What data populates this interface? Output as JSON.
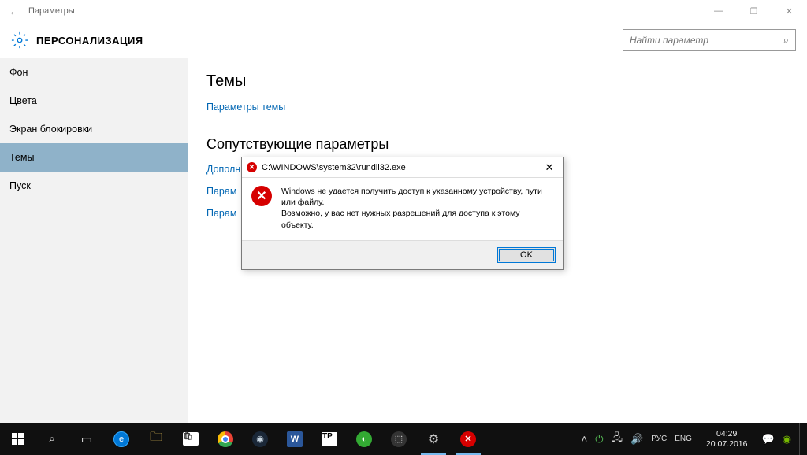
{
  "titlebar": {
    "title": "Параметры"
  },
  "header": {
    "section": "ПЕРСОНАЛИЗАЦИЯ",
    "search_placeholder": "Найти параметр"
  },
  "sidebar": {
    "items": [
      {
        "label": "Фон"
      },
      {
        "label": "Цвета"
      },
      {
        "label": "Экран блокировки"
      },
      {
        "label": "Темы"
      },
      {
        "label": "Пуск"
      }
    ]
  },
  "content": {
    "h1": "Темы",
    "link_theme_params": "Параметры темы",
    "h2": "Сопутствующие параметры",
    "link_advanced": "Дополн",
    "link_params2": "Парам",
    "link_params3": "Парам"
  },
  "dialog": {
    "path": "C:\\WINDOWS\\system32\\rundll32.exe",
    "line1": "Windows не удается получить доступ к указанному устройству, пути или файлу.",
    "line2": "Возможно, у вас нет нужных разрешений для доступа к этому объекту.",
    "ok": "OK"
  },
  "tray": {
    "lang1": "РУС",
    "lang2": "ENG",
    "time": "04:29",
    "date": "20.07.2016"
  }
}
